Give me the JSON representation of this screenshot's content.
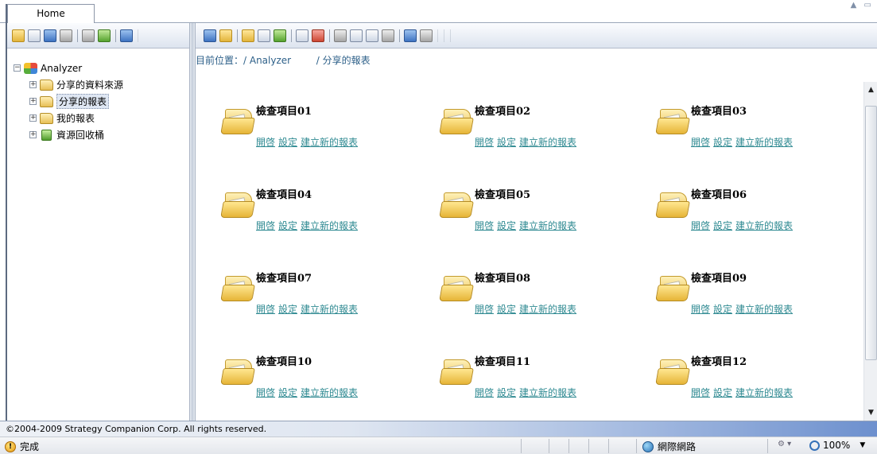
{
  "top": {
    "home_tab": "Home",
    "window_controls": "▲ ▭"
  },
  "sidebar": {
    "toolbar_icons": [
      "new-folder-icon",
      "properties-icon",
      "edit-icon",
      "search-icon",
      "home-icon",
      "tools-icon",
      "back-icon"
    ],
    "tree": {
      "root_label": "Analyzer",
      "items": [
        {
          "label": "分享的資料來源",
          "icon": "folder-icon",
          "selected": false
        },
        {
          "label": "分享的報表",
          "icon": "folder-icon",
          "selected": true
        },
        {
          "label": "我的報表",
          "icon": "folder-icon",
          "selected": false
        },
        {
          "label": "資源回收桶",
          "icon": "recycle-bin-icon",
          "selected": false
        }
      ]
    }
  },
  "main": {
    "toolbar_icons": [
      "export-icon",
      "up-folder-icon",
      "new-folder-icon",
      "new-report-icon",
      "new-analysis-icon",
      "properties-icon",
      "new-item-icon",
      "cut-icon",
      "copy-icon",
      "paste-icon",
      "paste-special-icon",
      "view-icon",
      "settings-icon"
    ],
    "breadcrumb": {
      "prefix": "目前位置：/ Analyzer",
      "current": "/ 分享的報表"
    },
    "links": {
      "open": "開啓",
      "settings": "設定",
      "new_report": "建立新的報表"
    },
    "items": [
      {
        "title": "檢查項目01"
      },
      {
        "title": "檢查項目02"
      },
      {
        "title": "檢查項目03"
      },
      {
        "title": "檢查項目04"
      },
      {
        "title": "檢查項目05"
      },
      {
        "title": "檢查項目06"
      },
      {
        "title": "檢查項目07"
      },
      {
        "title": "檢查項目08"
      },
      {
        "title": "檢查項目09"
      },
      {
        "title": "檢查項目10"
      },
      {
        "title": "檢查項目11"
      },
      {
        "title": "檢查項目12"
      }
    ]
  },
  "footer": {
    "copyright": "©2004-2009 Strategy Companion Corp. All rights reserved."
  },
  "status": {
    "text": "完成",
    "zone": "網際網路",
    "zoom": "100%"
  }
}
